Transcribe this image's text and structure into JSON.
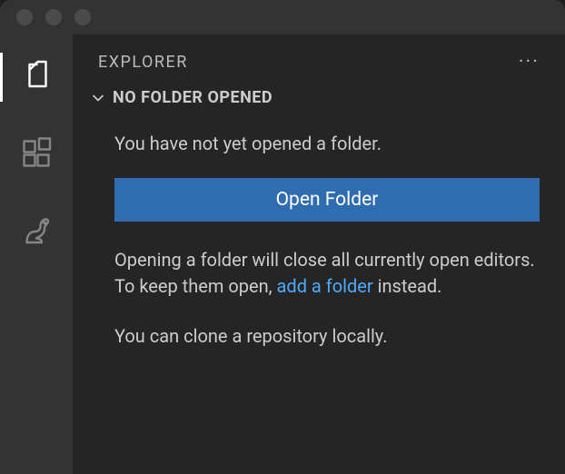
{
  "sidebar": {
    "title": "EXPLORER",
    "section_title": "NO FOLDER OPENED"
  },
  "content": {
    "no_folder_msg": "You have not yet opened a folder.",
    "open_folder_btn": "Open Folder",
    "closing_msg_pre": "Opening a folder will close all currently open editors. To keep them open, ",
    "add_folder_link": "add a folder",
    "closing_msg_post": " instead.",
    "clone_msg": "You can clone a repository locally."
  }
}
